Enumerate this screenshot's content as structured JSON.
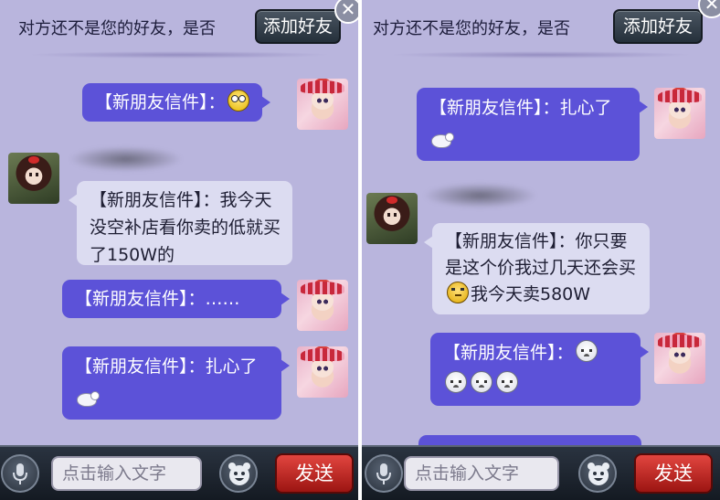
{
  "left": {
    "header": {
      "prompt": "对方还不是您的好友，是否",
      "add_friend": "添加好友"
    },
    "messages": [
      {
        "side": "out",
        "prefix": "【新朋友信件】：",
        "emojis": [
          "shocked-face"
        ]
      },
      {
        "side": "in",
        "text": "【新朋友信件】：我今天没空补店看你卖的低就买了150W的"
      },
      {
        "side": "out",
        "text": "【新朋友信件】：……"
      },
      {
        "side": "out",
        "text": "【新朋友信件】：扎心了",
        "emojis": [
          "sheep"
        ]
      }
    ],
    "footer": {
      "placeholder": "点击输入文字",
      "send": "发送"
    }
  },
  "right": {
    "header": {
      "prompt": "对方还不是您的好友，是否",
      "add_friend": "添加好友"
    },
    "messages": [
      {
        "side": "out",
        "text": "【新朋友信件】：扎心了",
        "emojis": [
          "sheep"
        ]
      },
      {
        "side": "in",
        "text_a": "【新朋友信件】：你只要是这个价我过几天还会买",
        "text_b": "我今天卖580W",
        "emojis": [
          "thinking-face"
        ]
      },
      {
        "side": "out",
        "prefix": "【新朋友信件】：",
        "emojis": [
          "sad-face",
          "sad-face",
          "sad-face",
          "sad-face"
        ]
      }
    ],
    "footer": {
      "placeholder": "点击输入文字",
      "send": "发送"
    }
  }
}
